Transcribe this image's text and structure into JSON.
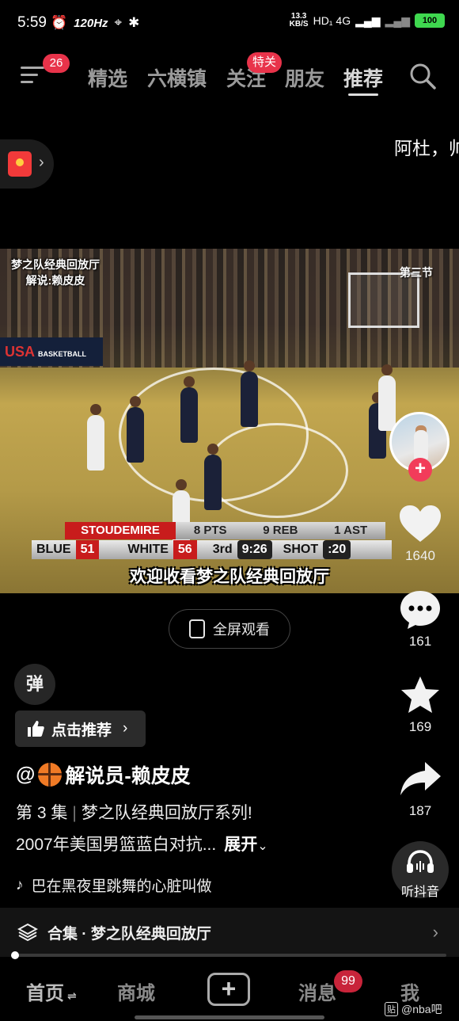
{
  "status_bar": {
    "time": "5:59",
    "refresh_rate": "120Hz",
    "net_speed_value": "13.3",
    "net_speed_unit": "KB/S",
    "network": "HD₁ 4G",
    "battery": "100"
  },
  "top_nav": {
    "menu_badge": "26",
    "tabs": [
      {
        "label": "精选"
      },
      {
        "label": "六横镇"
      },
      {
        "label": "关注"
      },
      {
        "label": "朋友"
      },
      {
        "label": "推荐"
      }
    ],
    "follow_badge": "特关",
    "active_tab": "推荐"
  },
  "danmaku_text": "阿杜，帅",
  "video": {
    "caption_top_left_1": "梦之队经典回放厅",
    "caption_top_left_2": "解说:赖皮皮",
    "caption_top_right": "第三节",
    "banner_usa": "USA",
    "banner_basketball": "BASKETBALL",
    "scoreboard": {
      "player": "STOUDEMIRE",
      "pts": "8 PTS",
      "reb": "9 REB",
      "ast": "1 AST",
      "team1": "BLUE",
      "score1": "51",
      "team2": "WHITE",
      "score2": "56",
      "quarter": "3rd",
      "clock": "9:26",
      "shot_label": "SHOT",
      "shot_clock": ":20"
    },
    "subtitle": "欢迎收看梦之队经典回放厅"
  },
  "fullscreen_label": "全屏观看",
  "right_rail": {
    "likes": "1640",
    "comments": "161",
    "favorites": "169",
    "shares": "187",
    "listen_label": "听抖音"
  },
  "info": {
    "danmu_label": "弹",
    "recommend_label": "点击推荐",
    "author_prefix": "@",
    "author_name": "解说员-赖皮皮",
    "episode": "第 3 集",
    "series": "梦之队经典回放厅系列!",
    "description": "2007年美国男篮蓝白对抗...",
    "expand": "展开",
    "music": "巴在黑夜里跳舞的心脏叫做",
    "collection": "合集 · 梦之队经典回放厅"
  },
  "bottom_nav": {
    "home": "首页",
    "mall": "商城",
    "plus": "+",
    "messages": "消息",
    "messages_badge": "99",
    "me": "我"
  },
  "watermark": "@nba吧",
  "watermark_logo": "贴",
  "colors": {
    "badge_red": "#e8334a",
    "battery_green": "#3fd84f",
    "score_red": "#c81c1c"
  }
}
